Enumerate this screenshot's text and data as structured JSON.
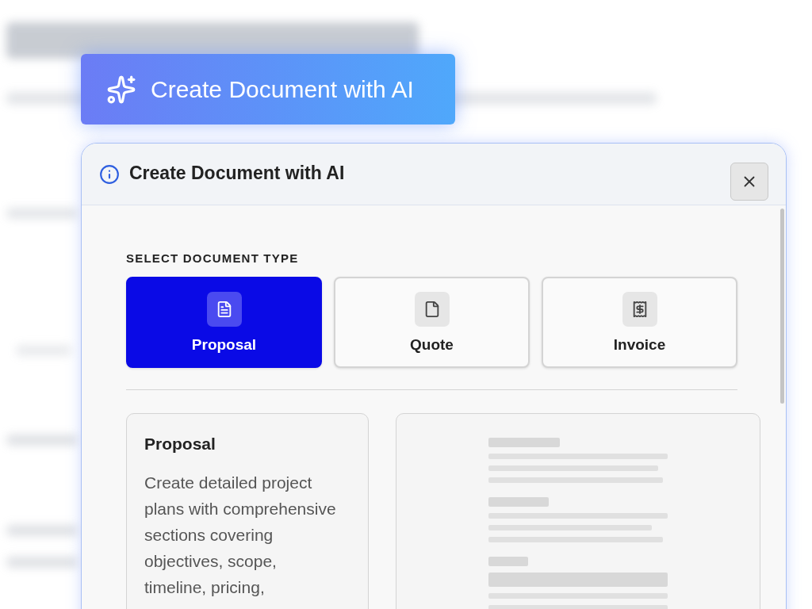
{
  "trigger_button": {
    "label": "Create Document with AI"
  },
  "dialog": {
    "title": "Create Document with AI",
    "section_label": "SELECT DOCUMENT TYPE",
    "types": [
      {
        "label": "Proposal",
        "kind": "proposal",
        "selected": true
      },
      {
        "label": "Quote",
        "kind": "quote",
        "selected": false
      },
      {
        "label": "Invoice",
        "kind": "invoice",
        "selected": false
      }
    ],
    "detail": {
      "title": "Proposal",
      "description": "Create detailed project plans with comprehensive sections covering objectives, scope, timeline, pricing,"
    }
  }
}
